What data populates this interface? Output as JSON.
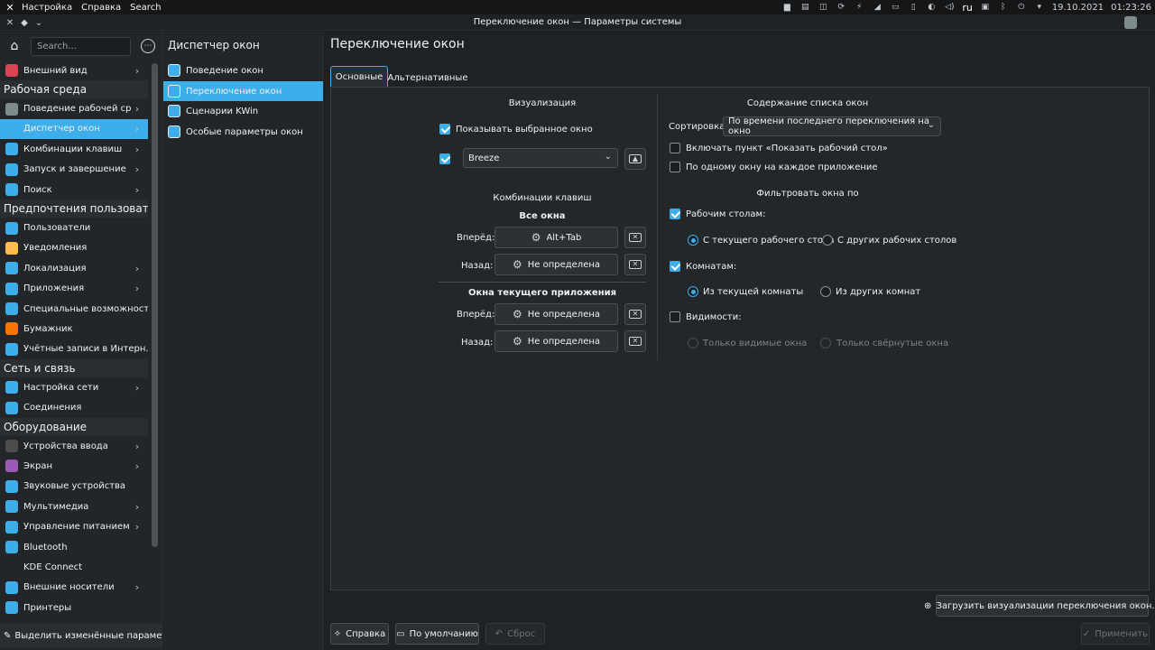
{
  "top_panel": {
    "menu": [
      "Настройка",
      "Справка",
      "Search"
    ],
    "lang": "ru",
    "date": "19.10.2021",
    "time": "01:23:26"
  },
  "window": {
    "title": "Переключение окон — Параметры системы"
  },
  "sidebar": {
    "search_placeholder": "Search...",
    "items": [
      {
        "label": "Внешний вид",
        "icon": "appearance-icon",
        "color": "#da4453",
        "chevron": true
      },
      {
        "header": "Рабочая среда"
      },
      {
        "label": "Поведение рабочей ср...",
        "icon": "workspace-behavior-icon",
        "color": "#7f8c8d",
        "chevron": true
      },
      {
        "label": "Диспетчер окон",
        "icon": "window-manager-icon",
        "color": "#3daee9",
        "chevron": true,
        "selected": true
      },
      {
        "label": "Комбинации клавиш",
        "icon": "shortcuts-icon",
        "color": "#3daee9",
        "chevron": true
      },
      {
        "label": "Запуск и завершение",
        "icon": "startup-shutdown-icon",
        "color": "#3daee9",
        "chevron": true
      },
      {
        "label": "Поиск",
        "icon": "search-icon",
        "color": "#3daee9",
        "chevron": true
      },
      {
        "header": "Предпочтения пользователя"
      },
      {
        "label": "Пользователи",
        "icon": "users-icon",
        "color": "#3daee9",
        "chevron": false
      },
      {
        "label": "Уведомления",
        "icon": "notifications-icon",
        "color": "#fdbc4b",
        "chevron": false
      },
      {
        "label": "Локализация",
        "icon": "localization-icon",
        "color": "#3daee9",
        "chevron": true
      },
      {
        "label": "Приложения",
        "icon": "applications-icon",
        "color": "#3daee9",
        "chevron": true
      },
      {
        "label": "Специальные возможности",
        "icon": "accessibility-icon",
        "color": "#3daee9",
        "chevron": false
      },
      {
        "label": "Бумажник",
        "icon": "wallet-icon",
        "color": "#f67400",
        "chevron": false
      },
      {
        "label": "Учётные записи в Интерн...",
        "icon": "online-accounts-icon",
        "color": "#3daee9",
        "chevron": false
      },
      {
        "header": "Сеть и связь"
      },
      {
        "label": "Настройка сети",
        "icon": "network-settings-icon",
        "color": "#3daee9",
        "chevron": true
      },
      {
        "label": "Соединения",
        "icon": "connections-icon",
        "color": "#3daee9",
        "chevron": false
      },
      {
        "header": "Оборудование"
      },
      {
        "label": "Устройства ввода",
        "icon": "input-devices-icon",
        "color": "#4d4d4d",
        "chevron": true
      },
      {
        "label": "Экран",
        "icon": "display-icon",
        "color": "#9b59b6",
        "chevron": true
      },
      {
        "label": "Звуковые устройства",
        "icon": "audio-icon",
        "color": "#3daee9",
        "chevron": false
      },
      {
        "label": "Мультимедиа",
        "icon": "multimedia-icon",
        "color": "#3daee9",
        "chevron": true
      },
      {
        "label": "Управление питанием",
        "icon": "power-icon",
        "color": "#3daee9",
        "chevron": true
      },
      {
        "label": "Bluetooth",
        "icon": "bluetooth-icon",
        "color": "#3daee9",
        "chevron": false
      },
      {
        "label": "KDE Connect",
        "icon": "kdeconnect-icon",
        "color": "#232629",
        "chevron": false
      },
      {
        "label": "Внешние носители",
        "icon": "removable-storage-icon",
        "color": "#3daee9",
        "chevron": true
      },
      {
        "label": "Принтеры",
        "icon": "printers-icon",
        "color": "#3daee9",
        "chevron": false
      }
    ],
    "highlight_changed": "Выделить изменённые параметр"
  },
  "middle": {
    "title": "Диспетчер окон",
    "items": [
      {
        "label": "Поведение окон",
        "selected": false
      },
      {
        "label": "Переключение окон",
        "selected": true
      },
      {
        "label": "Сценарии KWin",
        "selected": false
      },
      {
        "label": "Особые параметры окон",
        "selected": false
      }
    ]
  },
  "main": {
    "title": "Переключение окон",
    "tabs": [
      "Основные",
      "Альтернативные"
    ],
    "visualization": {
      "heading": "Визуализация",
      "show_selected_window": "Показывать выбранное окно",
      "theme_value": "Breeze"
    },
    "shortcuts": {
      "heading": "Комбинации клавиш",
      "all_windows": "Все окна",
      "current_app_windows": "Окна текущего приложения",
      "forward": "Вперёд:",
      "backward": "Назад:",
      "alt_tab": "Alt+Tab",
      "undefined": "Не определена"
    },
    "content": {
      "heading": "Содержание списка окон",
      "sort_label": "Сортировка:",
      "sort_value": "По времени последнего переключения на окно",
      "show_desktop": "Включать пункт «Показать рабочий стол»",
      "one_per_app": "По одному окну на каждое приложение"
    },
    "filter": {
      "heading": "Фильтровать окна по",
      "desktops": "Рабочим столам:",
      "current_desktop": "С текущего рабочего стола",
      "other_desktops": "С других рабочих столов",
      "activities": "Комнатам:",
      "current_activity": "Из текущей комнаты",
      "other_activities": "Из других комнат",
      "visibility": "Видимости:",
      "only_visible": "Только видимые окна",
      "only_minimized": "Только свёрнутые окна"
    },
    "download_button": "Загрузить визуализации переключения окон...",
    "footer": {
      "help": "Справка",
      "defaults": "По умолчанию",
      "reset": "Сброс",
      "apply": "Применить"
    }
  }
}
